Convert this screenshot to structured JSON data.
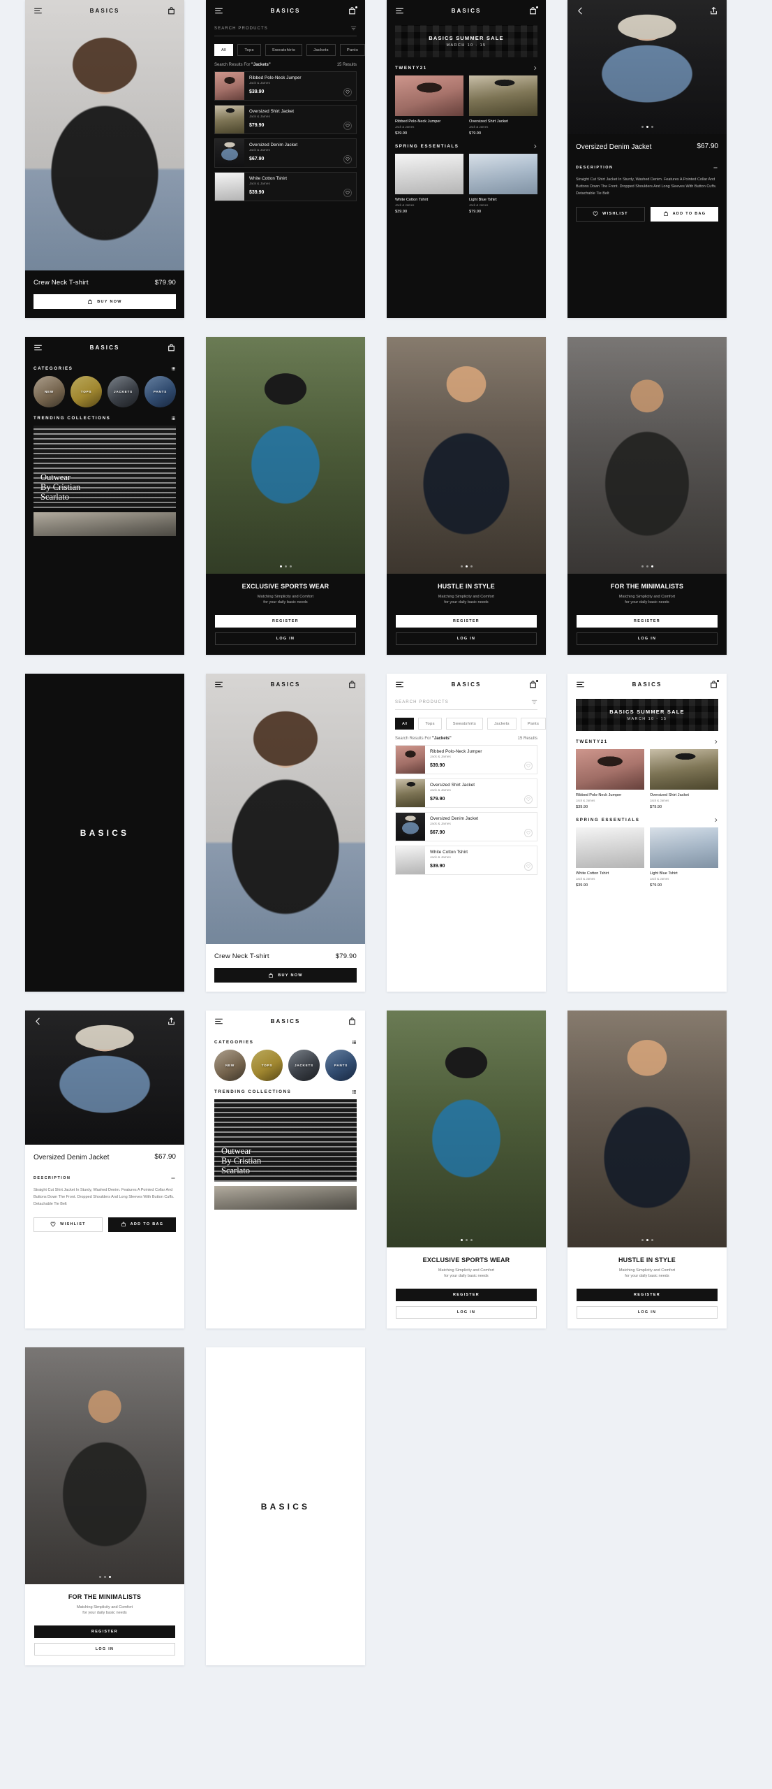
{
  "brand": "BASICS",
  "icons": {
    "menu": "menu-icon",
    "bag": "bag-icon",
    "filter": "filter-icon",
    "back": "back-chevron-icon",
    "share": "share-icon",
    "grid": "grid-icon",
    "chevron_right": "chevron-right-icon",
    "heart": "heart-icon",
    "minus": "minus-icon"
  },
  "product_card": {
    "name": "Crew Neck T-shirt",
    "price": "$79.90",
    "buy_label": "BUY NOW"
  },
  "search": {
    "placeholder": "SEARCH PRODUCTS",
    "chips": [
      "All",
      "Tops",
      "Sweatshirts",
      "Jackets",
      "Pants"
    ],
    "active_chip": "All",
    "results_label": "Search Results For",
    "results_query": "\"Jackets\"",
    "results_count": "15 Results",
    "items": [
      {
        "title": "Ribbed Polo-Neck Jumper",
        "brand": "Jack & James",
        "price": "$39.90"
      },
      {
        "title": "Oversized Shirt Jacket",
        "brand": "Jack & James",
        "price": "$79.90"
      },
      {
        "title": "Oversized Denim Jacket",
        "brand": "Jack & James",
        "price": "$67.90"
      },
      {
        "title": "White Cotton Tshirt",
        "brand": "Jack & James",
        "price": "$39.90"
      }
    ]
  },
  "home": {
    "banner_title": "BASICS SUMMER SALE",
    "banner_sub": "MARCH 10 - 15",
    "section1": "TWENTY21",
    "section2": "SPRING ESSENTIALS",
    "section1_items": [
      {
        "title": "Ribbed Polo-Neck Jumper",
        "brand": "Jack & James",
        "price": "$39.90"
      },
      {
        "title": "Oversized Shirt Jacket",
        "brand": "Jack & James",
        "price": "$79.90"
      }
    ],
    "section2_items": [
      {
        "title": "White Cotton Tshirt",
        "brand": "Jack & James",
        "price": "$39.90"
      },
      {
        "title": "Light Blue Tshirt",
        "brand": "Jack & James",
        "price": "$79.90"
      }
    ]
  },
  "categories": {
    "heading": "CATEGORIES",
    "items": [
      "NEW",
      "TOPS",
      "JACKETS",
      "PANTS"
    ],
    "trending_heading": "TRENDING COLLECTIONS",
    "collection_title": "Outwear\nBy Cristian\nScarlato"
  },
  "detail": {
    "name": "Oversized Denim Jacket",
    "price": "$67.90",
    "description_label": "DESCRIPTION",
    "description": "Straight Cut Shirt Jacket In Sturdy, Washed Denim. Features A Pointed Collar And Buttons Down The Front. Dropped Shoulders And Long Sleeves With Button Cuffs. Detachable Tie Belt",
    "wishlist_label": "WISHLIST",
    "addbag_label": "ADD TO BAG"
  },
  "onboarding": {
    "subtitle_line1": "Matching Simplicity and Comfort",
    "subtitle_line2": "for your daily basic needs",
    "register_label": "REGISTER",
    "login_label": "LOG IN",
    "slides": [
      {
        "title": "EXCLUSIVE SPORTS WEAR"
      },
      {
        "title": "HUSTLE IN STYLE"
      },
      {
        "title": "FOR THE MINIMALISTS"
      }
    ]
  },
  "splash": {
    "word": "BASICS"
  },
  "colors": {
    "background": "#eef1f5",
    "dark": "#0e0e0e",
    "light": "#ffffff",
    "accent": "#121212"
  }
}
